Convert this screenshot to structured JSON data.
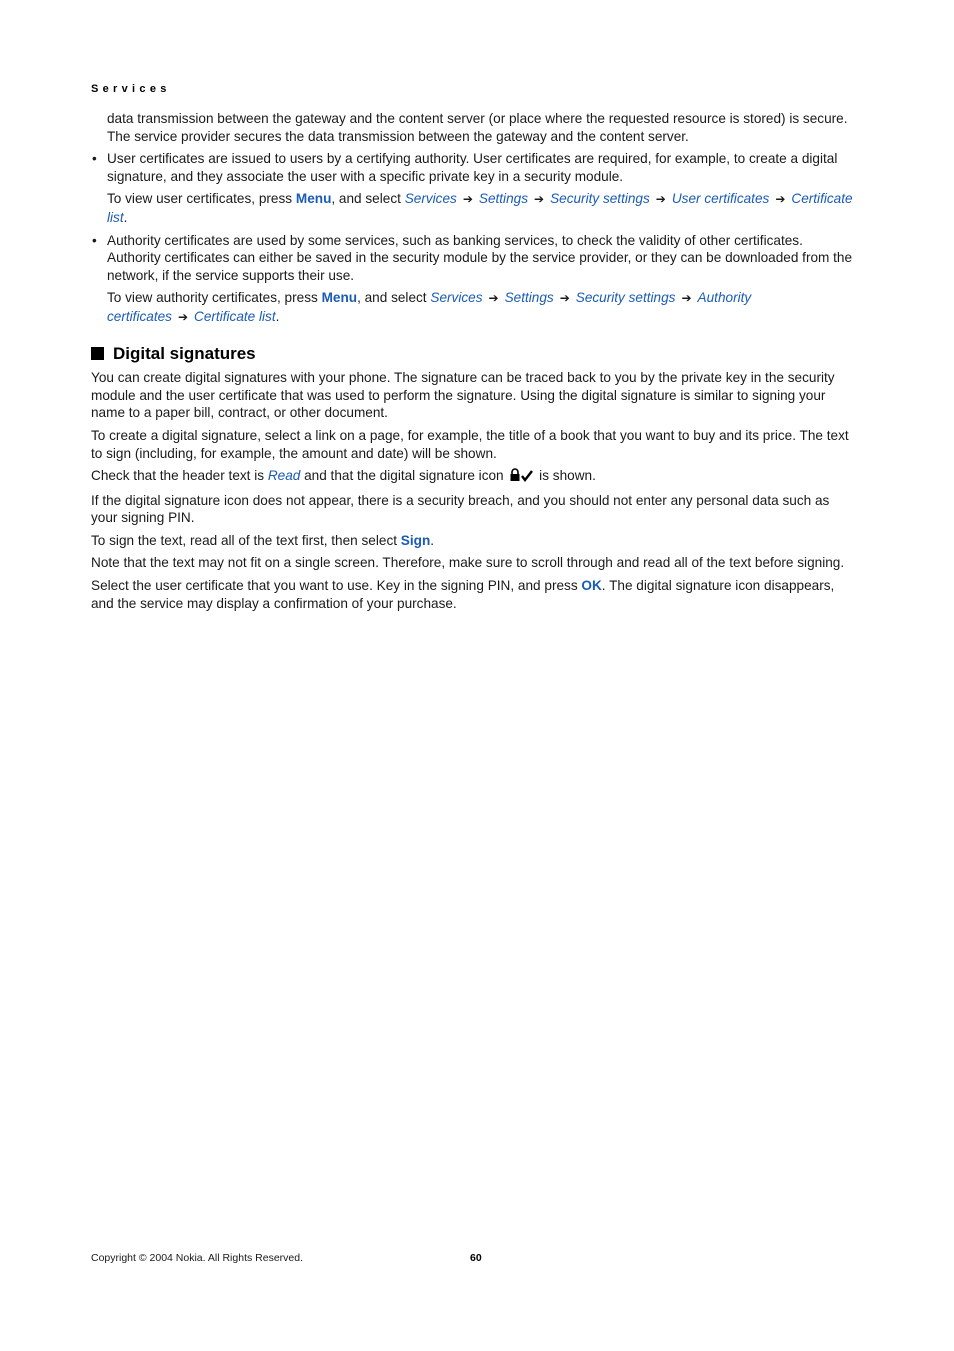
{
  "header": {
    "section": "Services"
  },
  "intro": {
    "continuation": "data transmission between the gateway and the content server (or place where the requested resource is stored) is secure. The service provider secures the data transmission between the gateway and the content server."
  },
  "bullets": [
    {
      "text": "User certificates are issued to users by a certifying authority. User certificates are required, for example, to create a digital signature, and they associate the user with a specific private key in a security module.",
      "instruction_prefix": "To view user certificates, press ",
      "key": "Menu",
      "instruction_mid": ", and select ",
      "path": [
        "Services",
        "Settings",
        "Security settings",
        "User certificates",
        "Certificate list"
      ],
      "arrow": "➔",
      "end": "."
    },
    {
      "text": "Authority certificates are used by some services, such as banking services, to check the validity of other certificates. Authority certificates can either be saved in the security module by the service provider, or they can be downloaded from the network, if the service supports their use.",
      "instruction_prefix": "To view authority certificates, press ",
      "key": "Menu",
      "instruction_mid": ", and select ",
      "path": [
        "Services",
        "Settings",
        "Security settings",
        "Authority certificates",
        "Certificate list"
      ],
      "arrow": "➔",
      "end": "."
    }
  ],
  "section": {
    "title": "Digital signatures",
    "p1": "You can create digital signatures with your phone. The signature can be traced back to you by the private key in the security module and the user certificate that was used to perform the signature. Using the digital signature is similar to signing your name to a paper bill, contract, or other document.",
    "p2": "To create a digital signature, select a link on a page, for example, the title of a book that you want to buy and its price. The text to sign (including, for example, the amount and date) will be shown.",
    "p3_a": "Check that the header text is ",
    "p3_read": "Read",
    "p3_b": " and that the digital signature icon ",
    "p3_c": " is shown.",
    "p4": "If the digital signature icon does not appear, there is a security breach, and you should not enter any personal data such as your signing PIN.",
    "p5_a": "To sign the text, read all of the text first, then select ",
    "p5_sign": "Sign",
    "p5_b": ".",
    "p6": "Note that the text may not fit on a single screen. Therefore, make sure to scroll through and read all of the text before signing.",
    "p7_a": "Select the user certificate that you want to use. Key in the signing PIN, and press ",
    "p7_ok": "OK",
    "p7_b": ". The digital signature icon disappears, and the service may display a confirmation of your purchase."
  },
  "footer": {
    "copyright": "Copyright © 2004 Nokia. All Rights Reserved.",
    "page": "60"
  }
}
